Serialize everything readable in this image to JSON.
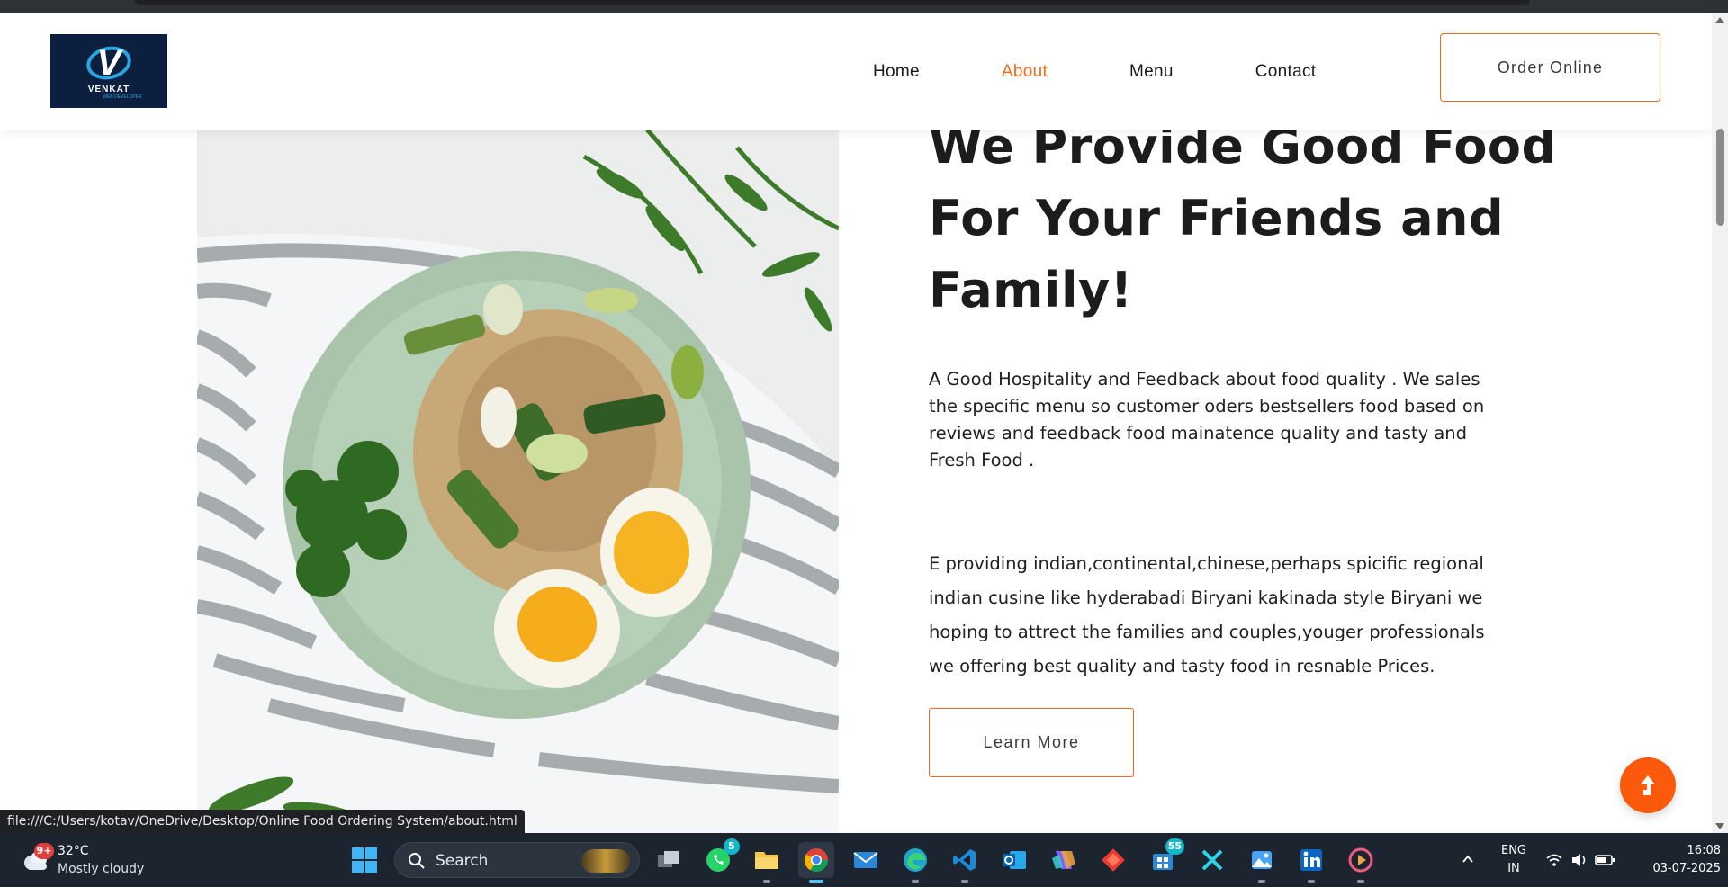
{
  "browser": {
    "status_url": "file:///C:/Users/kotav/OneDrive/Desktop/Online Food Ordering System/about.html"
  },
  "header": {
    "logo": {
      "brand": "VENKAT",
      "sub": "WEB DEVELOPER",
      "letter": "V"
    },
    "nav": [
      {
        "label": "Home",
        "active": false
      },
      {
        "label": "About",
        "active": true
      },
      {
        "label": "Menu",
        "active": false
      },
      {
        "label": "Contact",
        "active": false
      }
    ],
    "order_button": "Order Online"
  },
  "about": {
    "heading_lines": [
      "We Provide Good Food",
      "For Your Friends and",
      "Family!"
    ],
    "paragraph1": "A Good Hospitality and Feedback about food quality . We sales the specific menu so customer oders bestsellers food based on reviews and feedback food mainatence quality and tasty and Fresh Food .",
    "paragraph2": "E providing indian,continental,chinese,perhaps spicific regional indian cusine like hyderabadi Biryani kakinada style Biryani we hoping to attrect the families and couples,youger professionals we offering best quality and tasty food in resnable Prices.",
    "learn_more": "Learn More",
    "image_alt_icon": "food-plate-image"
  },
  "colors": {
    "accent": "#f26b1d",
    "scroll_top": "#fb5a0c",
    "logo_bg": "#0d1f3f",
    "taskbar": "#1c2430"
  },
  "taskbar": {
    "weather": {
      "badge": "9+",
      "temp": "32°C",
      "condition": "Mostly cloudy"
    },
    "search_label": "Search",
    "apps": [
      {
        "name": "task-view-icon",
        "badge": ""
      },
      {
        "name": "whatsapp-icon",
        "badge": "5"
      },
      {
        "name": "file-explorer-icon",
        "badge": ""
      },
      {
        "name": "chrome-icon",
        "badge": ""
      },
      {
        "name": "mail-icon",
        "badge": ""
      },
      {
        "name": "edge-icon",
        "badge": ""
      },
      {
        "name": "vscode-icon",
        "badge": ""
      },
      {
        "name": "outlook-icon",
        "badge": ""
      },
      {
        "name": "copilot-icon",
        "badge": ""
      },
      {
        "name": "git-icon",
        "badge": ""
      },
      {
        "name": "store-icon",
        "badge": "55"
      },
      {
        "name": "xcode-icon",
        "badge": ""
      },
      {
        "name": "photos-icon",
        "badge": ""
      },
      {
        "name": "linkedin-icon",
        "badge": ""
      },
      {
        "name": "media-player-icon",
        "badge": ""
      }
    ],
    "lang_line1": "ENG",
    "lang_line2": "IN",
    "time": "16:08",
    "date": "03-07-2025"
  }
}
